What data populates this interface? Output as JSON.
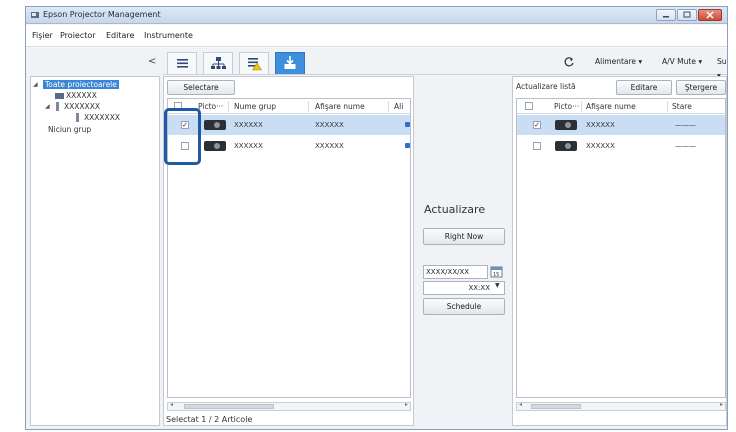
{
  "window": {
    "title": "Epson Projector Management"
  },
  "menu": [
    "Fişier",
    "Proiector",
    "Editare",
    "Instrumente"
  ],
  "toolbar": {
    "collapse_label": "<",
    "refresh_icon": "refresh-icon",
    "alimentare": "Alimentare ▾",
    "av_mute": "A/V Mute ▾",
    "sursa": "Sursă ▾"
  },
  "tree": {
    "root": "Toate proiectoarele",
    "item1": "XXXXXX",
    "group1": "XXXXXXX",
    "item2": "XXXXXXX",
    "no_group": "Niciun grup"
  },
  "left": {
    "select_button": "Selectare",
    "columns": [
      "Picto···",
      "Nume grup",
      "Afişare nume",
      "Ali"
    ],
    "rows": [
      {
        "checked": true,
        "group": "XXXXXX",
        "name": "XXXXXX"
      },
      {
        "checked": false,
        "group": "XXXXXX",
        "name": "XXXXXX"
      }
    ],
    "status_label": "Selectat",
    "status_count": "1 / 2",
    "status_suffix": "Articole"
  },
  "middle": {
    "title": "Actualizare",
    "right_now": "Right Now",
    "date": "XXXX/XX/XX",
    "time": "XX:XX",
    "schedule": "Schedule"
  },
  "right": {
    "list_label": "Actualizare listă",
    "edit_button": "Editare",
    "delete_button": "Ştergere",
    "columns": [
      "Picto···",
      "Afişare nume",
      "Stare"
    ],
    "rows": [
      {
        "checked": true,
        "name": "XXXXXX",
        "state": "———"
      },
      {
        "checked": false,
        "name": "XXXXXX",
        "state": "———"
      }
    ]
  },
  "colors": {
    "accent": "#3e8fdc",
    "highlight": "#1f5aa6",
    "selection": "#c9def4"
  }
}
